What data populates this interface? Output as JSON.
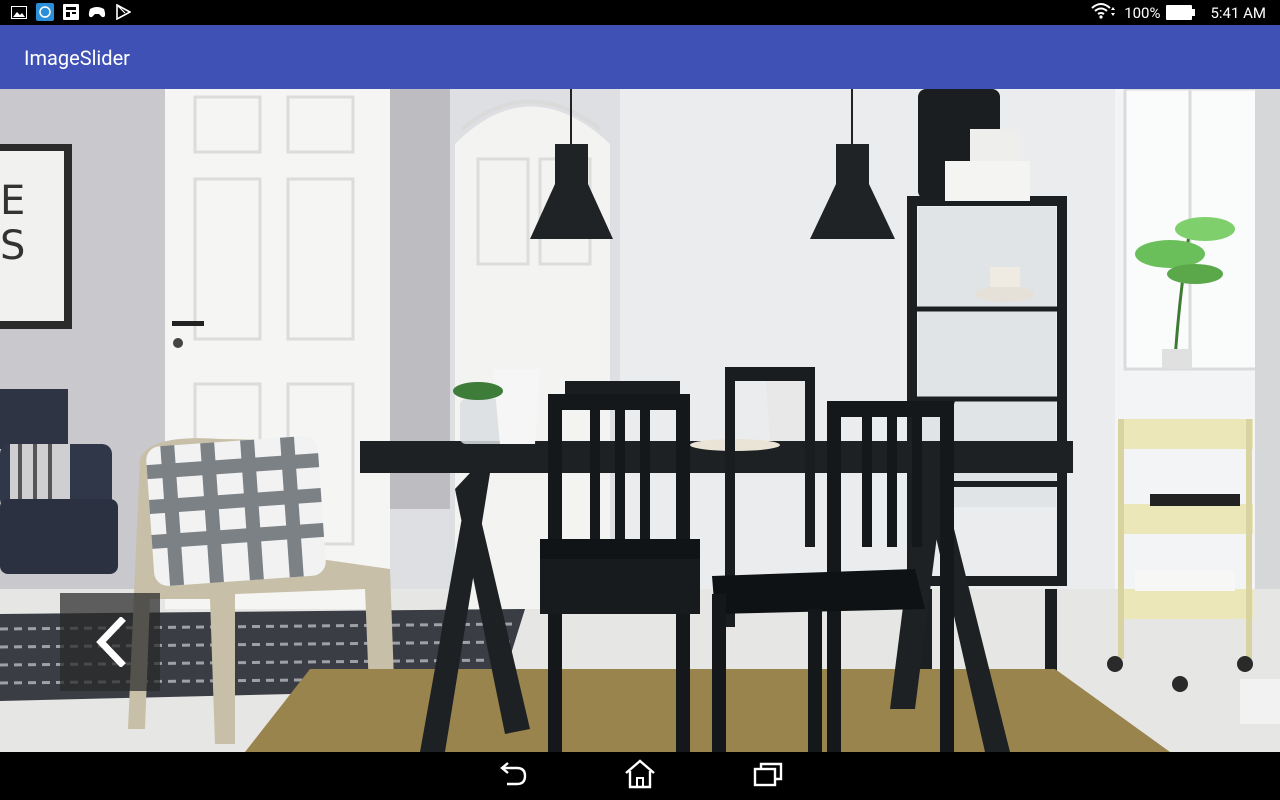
{
  "status_bar": {
    "battery_percent": "100%",
    "time": "5:41 AM",
    "left_icons": [
      "gallery-icon",
      "app-icon",
      "news-icon",
      "game-controller-icon",
      "play-store-icon"
    ],
    "right_icons": [
      "wifi-icon",
      "battery-icon"
    ]
  },
  "app_bar": {
    "title": "ImageSlider",
    "color": "#3f51b5"
  },
  "slider": {
    "image_description": "dining-room-photo",
    "prev_icon": "chevron-left-icon"
  },
  "nav_bar": {
    "buttons": [
      "back-icon",
      "home-icon",
      "recents-icon"
    ]
  }
}
